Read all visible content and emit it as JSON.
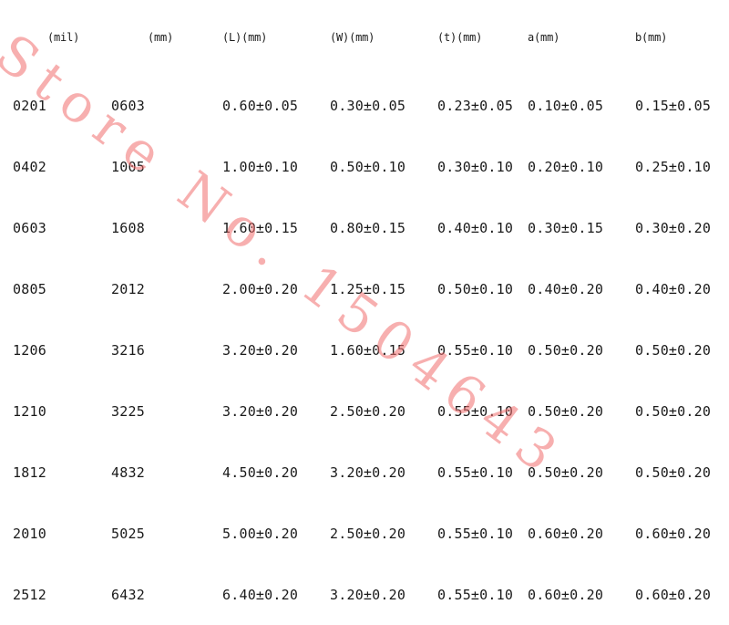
{
  "table": {
    "headers": [
      "(mil)",
      "(mm)",
      "(L)(mm)",
      "(W)(mm)",
      "(t)(mm)",
      "a(mm)",
      "b(mm)"
    ],
    "rows": [
      [
        "0201",
        "0603",
        "0.60±0.05",
        "0.30±0.05",
        "0.23±0.05",
        "0.10±0.05",
        "0.15±0.05"
      ],
      [
        "0402",
        "1005",
        "1.00±0.10",
        "0.50±0.10",
        "0.30±0.10",
        "0.20±0.10",
        "0.25±0.10"
      ],
      [
        "0603",
        "1608",
        "1.60±0.15",
        "0.80±0.15",
        "0.40±0.10",
        "0.30±0.15",
        "0.30±0.20"
      ],
      [
        "0805",
        "2012",
        "2.00±0.20",
        "1.25±0.15",
        "0.50±0.10",
        "0.40±0.20",
        "0.40±0.20"
      ],
      [
        "1206",
        "3216",
        "3.20±0.20",
        "1.60±0.15",
        "0.55±0.10",
        "0.50±0.20",
        "0.50±0.20"
      ],
      [
        "1210",
        "3225",
        "3.20±0.20",
        "2.50±0.20",
        "0.55±0.10",
        "0.50±0.20",
        "0.50±0.20"
      ],
      [
        "1812",
        "4832",
        "4.50±0.20",
        "3.20±0.20",
        "0.55±0.10",
        "0.50±0.20",
        "0.50±0.20"
      ],
      [
        "2010",
        "5025",
        "5.00±0.20",
        "2.50±0.20",
        "0.55±0.10",
        "0.60±0.20",
        "0.60±0.20"
      ],
      [
        "2512",
        "6432",
        "6.40±0.20",
        "3.20±0.20",
        "0.55±0.10",
        "0.60±0.20",
        "0.60±0.20"
      ]
    ]
  },
  "watermark": {
    "text": "Store No. 1504643",
    "color": "#f06e6e"
  }
}
